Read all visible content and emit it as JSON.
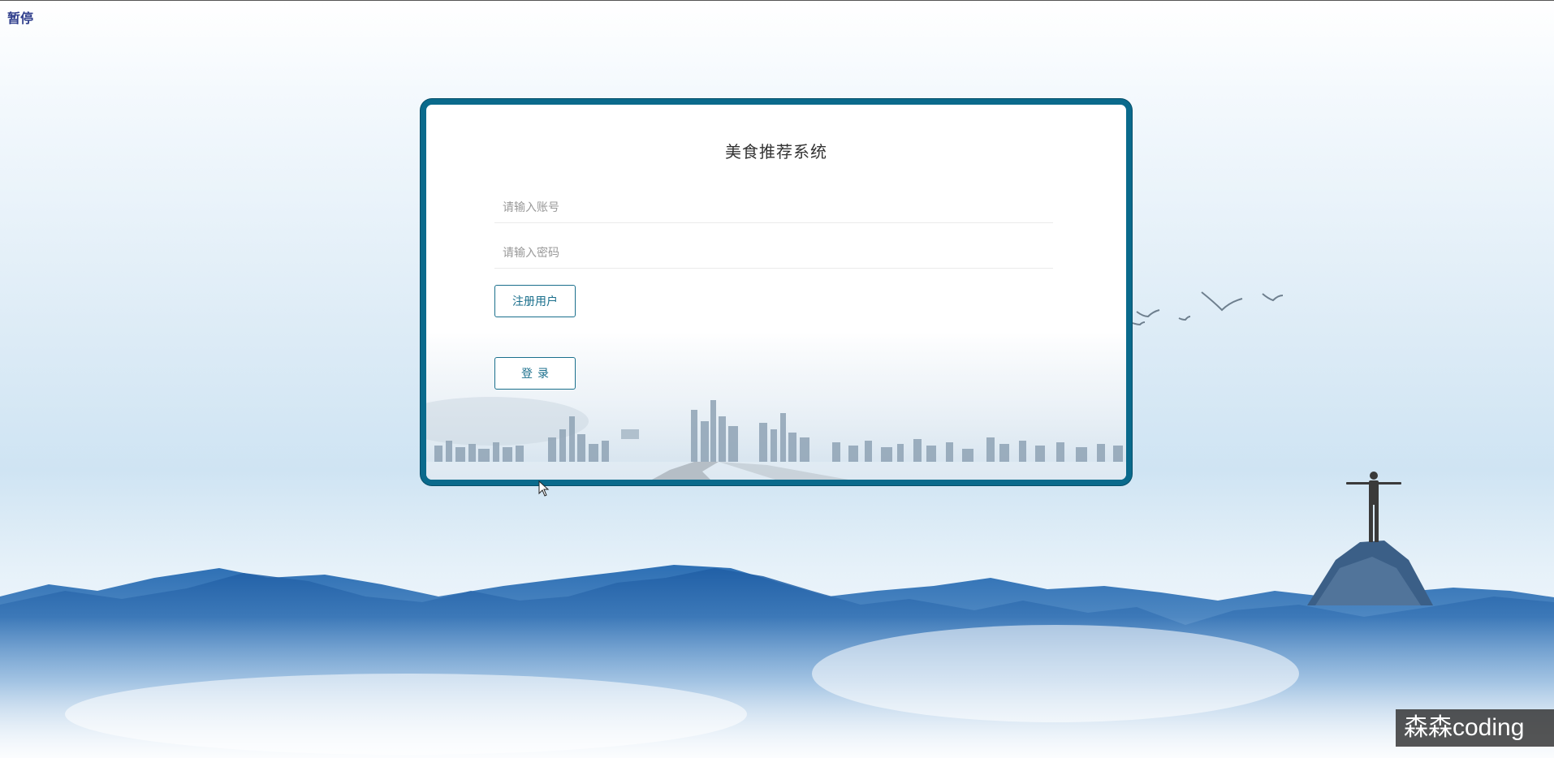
{
  "overlay": {
    "pause_label": "暂停"
  },
  "login": {
    "title": "美食推荐系统",
    "account_placeholder": "请输入账号",
    "password_placeholder": "请输入密码",
    "register_label": "注册用户",
    "login_label": "登录"
  },
  "watermark": {
    "text": "森森coding"
  },
  "colors": {
    "accent": "#0a6a8c",
    "button_text": "#1a6f8c"
  }
}
